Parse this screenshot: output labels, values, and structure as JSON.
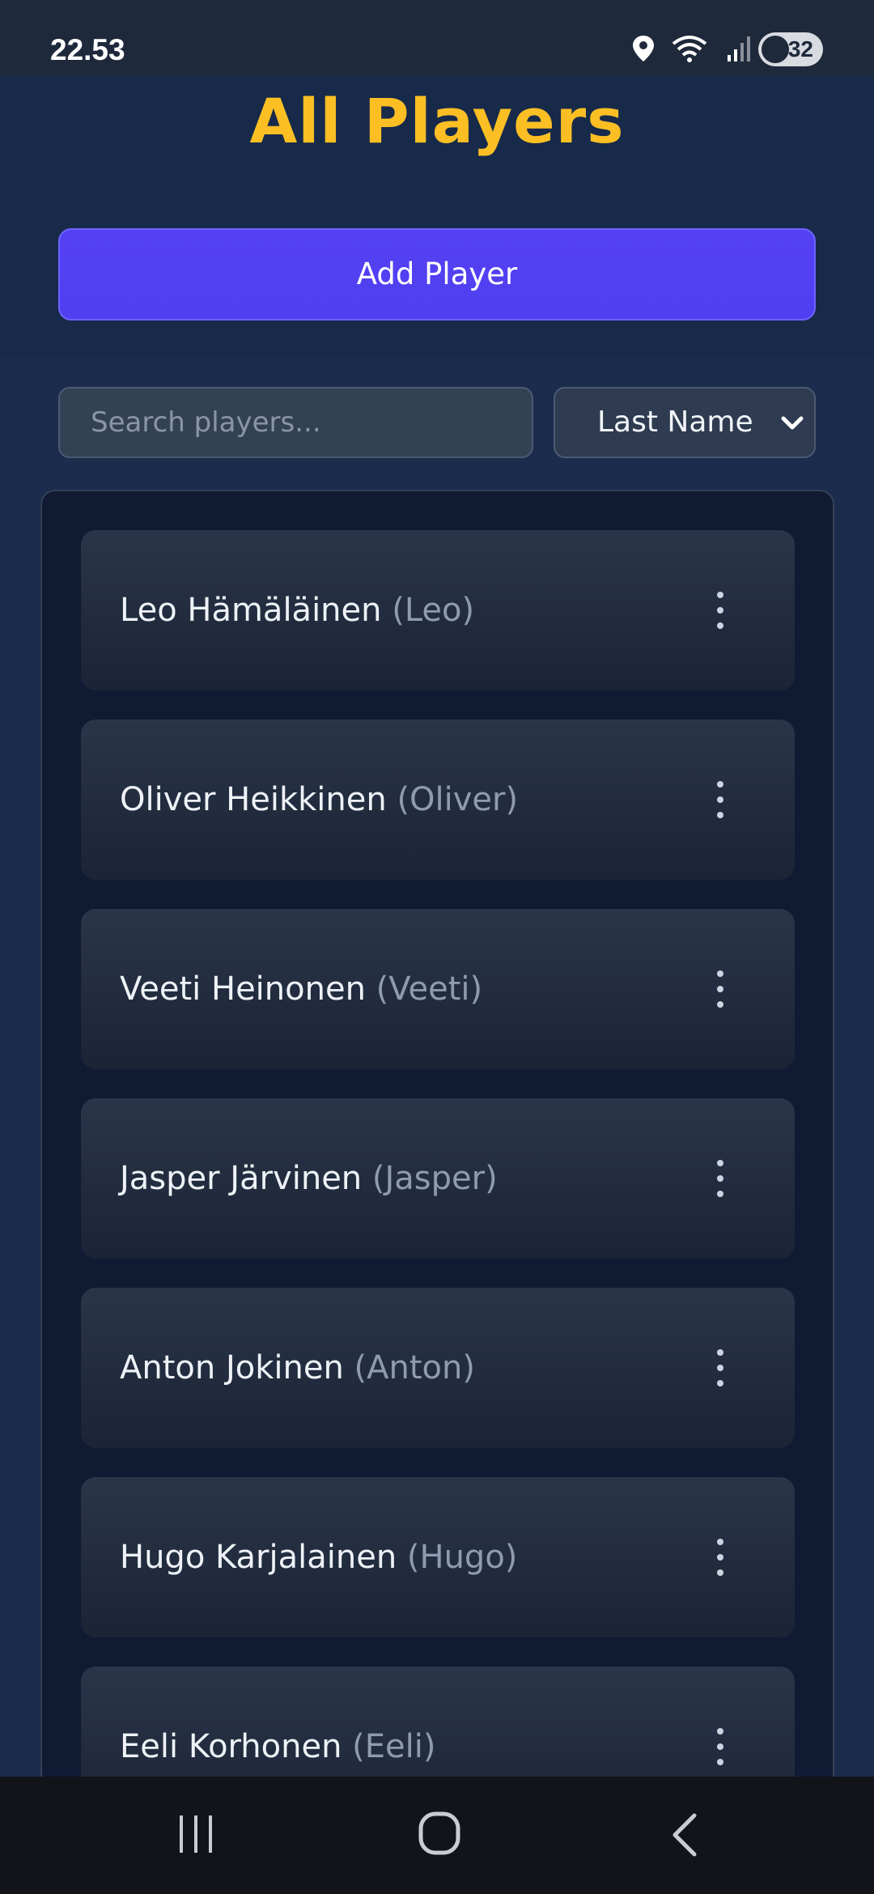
{
  "status_bar": {
    "time": "22.53",
    "battery": "32"
  },
  "title": "All Players",
  "add_player_label": "Add Player",
  "search": {
    "placeholder": "Search players...",
    "value": ""
  },
  "sort": {
    "selected": "Last Name"
  },
  "players": [
    {
      "name": "Leo Hämäläinen",
      "nickname": "(Leo)"
    },
    {
      "name": "Oliver Heikkinen",
      "nickname": "(Oliver)"
    },
    {
      "name": "Veeti Heinonen",
      "nickname": "(Veeti)"
    },
    {
      "name": "Jasper Järvinen",
      "nickname": "(Jasper)"
    },
    {
      "name": "Anton Jokinen",
      "nickname": "(Anton)"
    },
    {
      "name": "Hugo Karjalainen",
      "nickname": "(Hugo)"
    },
    {
      "name": "Eeli Korhonen",
      "nickname": "(Eeli)"
    }
  ],
  "colors": {
    "title": "#fbbf24",
    "accent_button": "#4f46e5",
    "background": "#1c2c4d",
    "card": "#242e42"
  },
  "icons": {
    "status": [
      "location-icon",
      "wifi-icon",
      "signal-icon",
      "battery-icon"
    ],
    "card_menu": "more-vertical-icon",
    "nav": [
      "recents-icon",
      "home-icon",
      "back-icon"
    ]
  }
}
